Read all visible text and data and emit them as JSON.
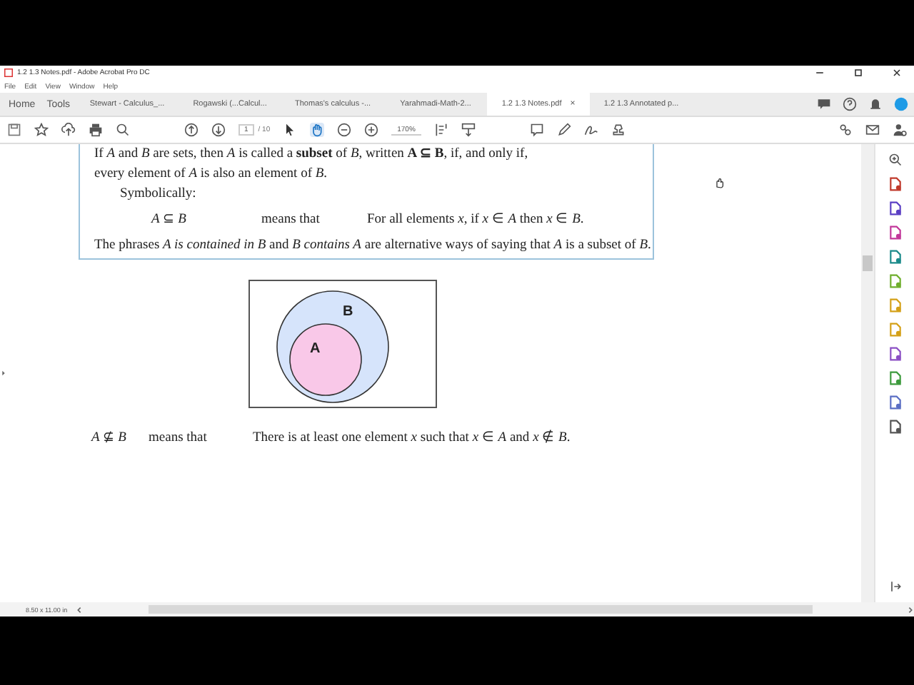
{
  "window": {
    "title": "1.2 1.3 Notes.pdf - Adobe Acrobat Pro DC"
  },
  "menu": [
    "File",
    "Edit",
    "View",
    "Window",
    "Help"
  ],
  "nav_tabs": [
    {
      "label": "Home",
      "selected": false
    },
    {
      "label": "Tools",
      "selected": false
    }
  ],
  "doc_tabs": [
    {
      "label": "Stewart - Calculus_...",
      "selected": false
    },
    {
      "label": "Rogawski (...Calcul...",
      "selected": false
    },
    {
      "label": "Thomas's calculus -...",
      "selected": false
    },
    {
      "label": "Yarahmadi-Math-2...",
      "selected": false
    },
    {
      "label": "1.2 1.3 Notes.pdf",
      "selected": true,
      "close": "×"
    },
    {
      "label": "1.2 1.3 Annotated p...",
      "selected": false
    }
  ],
  "toolbar": {
    "page": "1",
    "page_count": "/ 10",
    "zoom": "170%",
    "hand_selected": true
  },
  "document": {
    "paragraphs": [
      "If *A* and *B* are sets, then *A* is called a **subset** of *B*, written **A ⊆ B**, if, and only if,",
      "every element of *A* is also an element of *B*."
    ],
    "symbolically": "Symbolically:",
    "definition": {
      "left": "*A* ⊆ *B*",
      "middle": "means that",
      "right": "For all elements *x*, if *x* ∈ *A* then *x* ∈ *B*."
    },
    "remark": "The phrases *A is contained in B* and *B contains A* are alternative ways of saying that *A* is a subset of *B*.",
    "venn": {
      "outer_label": "B",
      "inner_label": "A"
    },
    "negation": {
      "left": "*A* ⊈ *B*",
      "middle": "means that",
      "right": "There is at least one element *x* such that *x* ∈ *A* and *x* ∉ *B*."
    }
  },
  "status_bar": {
    "page_size": "8.50 x 11.00 in"
  }
}
